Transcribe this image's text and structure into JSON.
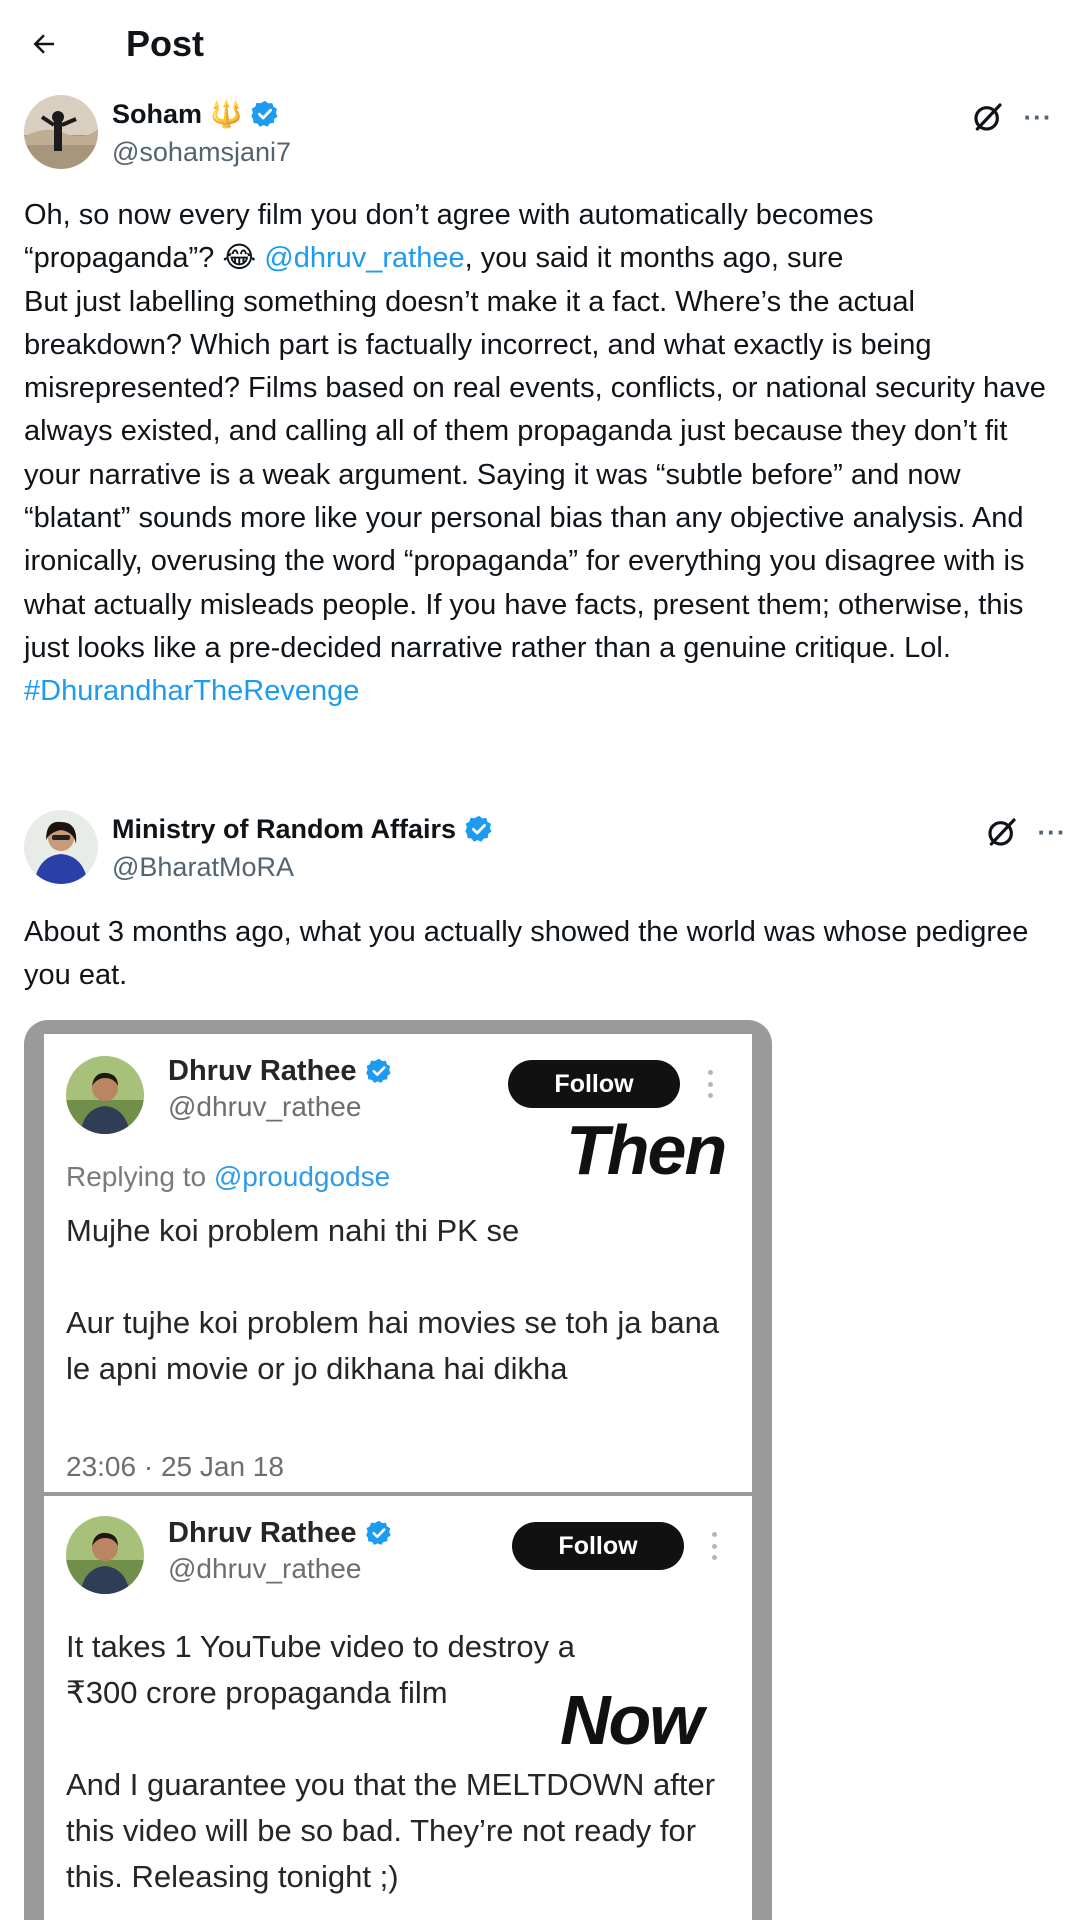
{
  "header": {
    "title": "Post",
    "back_icon": "arrow-left-icon"
  },
  "post": {
    "author_name": "Soham",
    "author_emoji": "🔱",
    "author_handle": "@sohamsjani7",
    "verified": true,
    "text_parts": [
      "Oh, so now every film you don’t agree with automatically becomes “propaganda”? 😂 ",
      "@dhruv_rathee",
      ", you said it months ago, sure\nBut just labelling something doesn’t make it a fact. Where’s the actual breakdown? Which part is factually incorrect, and what exactly is being misrepresented? Films based on real events, conflicts, or national security have always existed, and calling all of them propaganda just because they don’t fit your narrative is a weak argument. Saying it was “subtle before” and now “blatant” sounds more like your personal bias than any objective analysis. And ironically, overusing the word “propaganda” for everything you disagree with is what actually misleads people. If you have facts, present them; otherwise, this just looks like a pre-decided narrative rather than a genuine critique. Lol.\n",
      "#DhurandharTheRevenge"
    ]
  },
  "reply": {
    "author_name": "Ministry of Random Affairs",
    "author_handle": "@BharatMoRA",
    "verified": true,
    "text": "About 3 months ago, what you actually showed the world was whose pedigree you eat."
  },
  "media": {
    "tweet_then": {
      "name": "Dhruv Rathee",
      "handle": "@dhruv_rathee",
      "follow_label": "Follow",
      "stamp": "Then",
      "replying_prefix": "Replying to ",
      "replying_handle": "@proudgodse",
      "text": "Mujhe koi problem nahi thi PK se\n\nAur tujhe koi problem hai movies se toh ja bana le apni movie or jo dikhana hai dikha",
      "time": "23:06 · 25 Jan 18"
    },
    "tweet_now": {
      "name": "Dhruv Rathee",
      "handle": "@dhruv_rathee",
      "follow_label": "Follow",
      "stamp": "Now",
      "text_line1": "It takes 1 YouTube video to destroy a",
      "text_line2": "₹300 crore propaganda film",
      "text_rest": "And I guarantee you that the MELTDOWN after this video will be so bad. They’re not ready for this. Releasing tonight ;)"
    }
  },
  "colors": {
    "link": "#1d9bf0",
    "verified": "#1d9bf0",
    "secondary": "#536471"
  }
}
